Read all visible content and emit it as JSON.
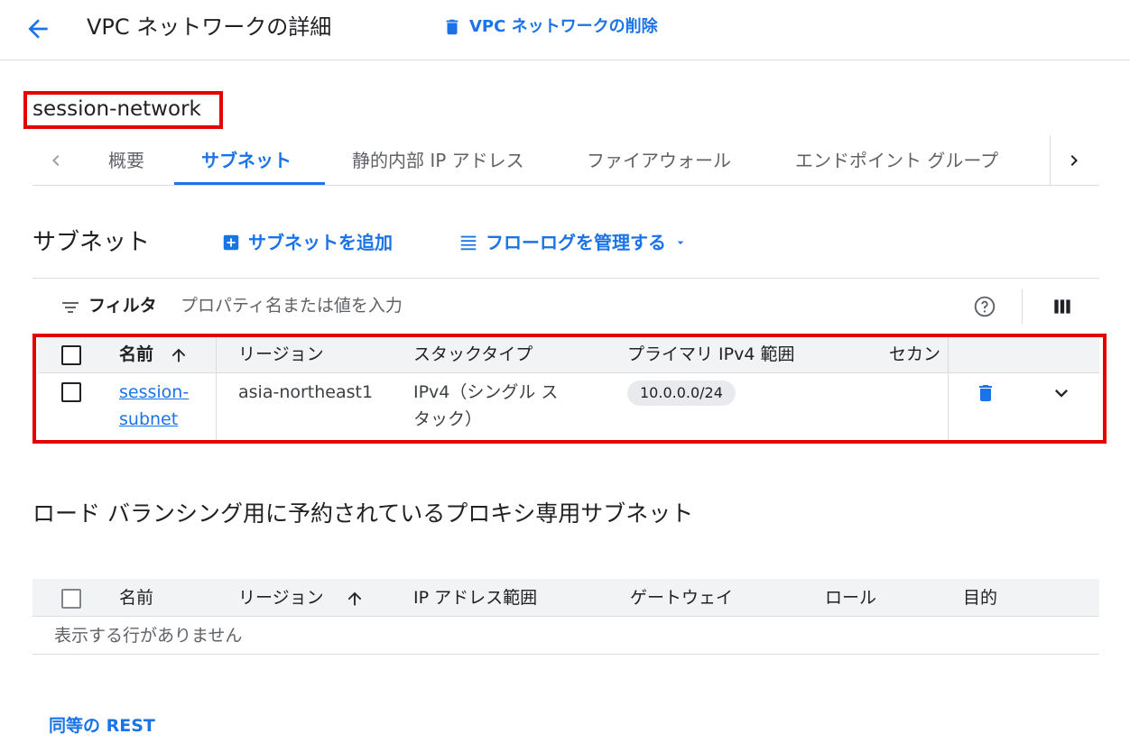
{
  "header": {
    "title": "VPC ネットワークの詳細",
    "delete_label": "VPC ネットワークの削除"
  },
  "network_name": "session-network",
  "tabs": [
    {
      "label": "概要",
      "active": false
    },
    {
      "label": "サブネット",
      "active": true
    },
    {
      "label": "静的内部 IP アドレス",
      "active": false
    },
    {
      "label": "ファイアウォール",
      "active": false
    },
    {
      "label": "エンドポイント グループ",
      "active": false
    }
  ],
  "subnets": {
    "title": "サブネット",
    "add_label": "サブネットを追加",
    "flowlog_label": "フローログを管理する",
    "filter_label": "フィルタ",
    "filter_placeholder": "プロパティ名または値を入力",
    "columns": [
      "名前",
      "リージョン",
      "スタックタイプ",
      "プライマリ IPv4 範囲",
      "セカン"
    ],
    "rows": [
      {
        "name_line1": "session-",
        "name_line2": "subnet",
        "region": "asia-northeast1",
        "stack_line1": "IPv4（シングル ス",
        "stack_line2": "タック）",
        "ipv4_range": "10.0.0.0/24"
      }
    ]
  },
  "proxy_subnets": {
    "title": "ロード バランシング用に予約されているプロキシ専用サブネット",
    "columns": [
      "名前",
      "リージョン",
      "IP アドレス範囲",
      "ゲートウェイ",
      "ロール",
      "目的"
    ],
    "empty_text": "表示する行がありません"
  },
  "rest_link": "同等の REST",
  "colors": {
    "accent": "#1a73e8",
    "highlight_box": "#e50000",
    "header_bg": "#f1f3f4"
  }
}
